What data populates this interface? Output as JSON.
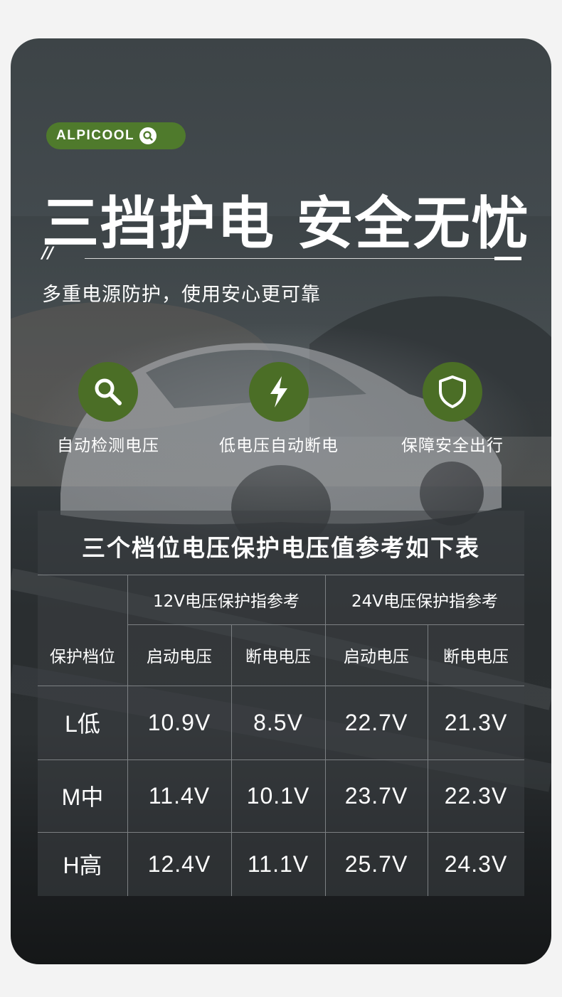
{
  "brand": {
    "name": "ALPICOOL",
    "accent_color": "#4f7a2c",
    "badge_icon": "search-icon"
  },
  "headline": "三挡护电  安全无忧",
  "slashes": "//",
  "subtitle": "多重电源防护，使用安心更可靠",
  "features": [
    {
      "icon": "magnifier-icon",
      "label": "自动检测电压"
    },
    {
      "icon": "lightning-icon",
      "label": "低电压自动断电"
    },
    {
      "icon": "shield-icon",
      "label": "保障安全出行"
    }
  ],
  "table": {
    "title": "三个档位电压保护电压值参考如下表",
    "group_headers": [
      "12V电压保护指参考",
      "24V电压保护指参考"
    ],
    "level_header": "保护档位",
    "sub_headers": [
      "启动电压",
      "断电电压",
      "启动电压",
      "断电电压"
    ],
    "rows": [
      {
        "level": "L低",
        "values": [
          "10.9V",
          "8.5V",
          "22.7V",
          "21.3V"
        ]
      },
      {
        "level": "M中",
        "values": [
          "11.4V",
          "10.1V",
          "23.7V",
          "22.3V"
        ]
      },
      {
        "level": "H高",
        "values": [
          "12.4V",
          "11.1V",
          "25.7V",
          "24.3V"
        ]
      }
    ]
  }
}
